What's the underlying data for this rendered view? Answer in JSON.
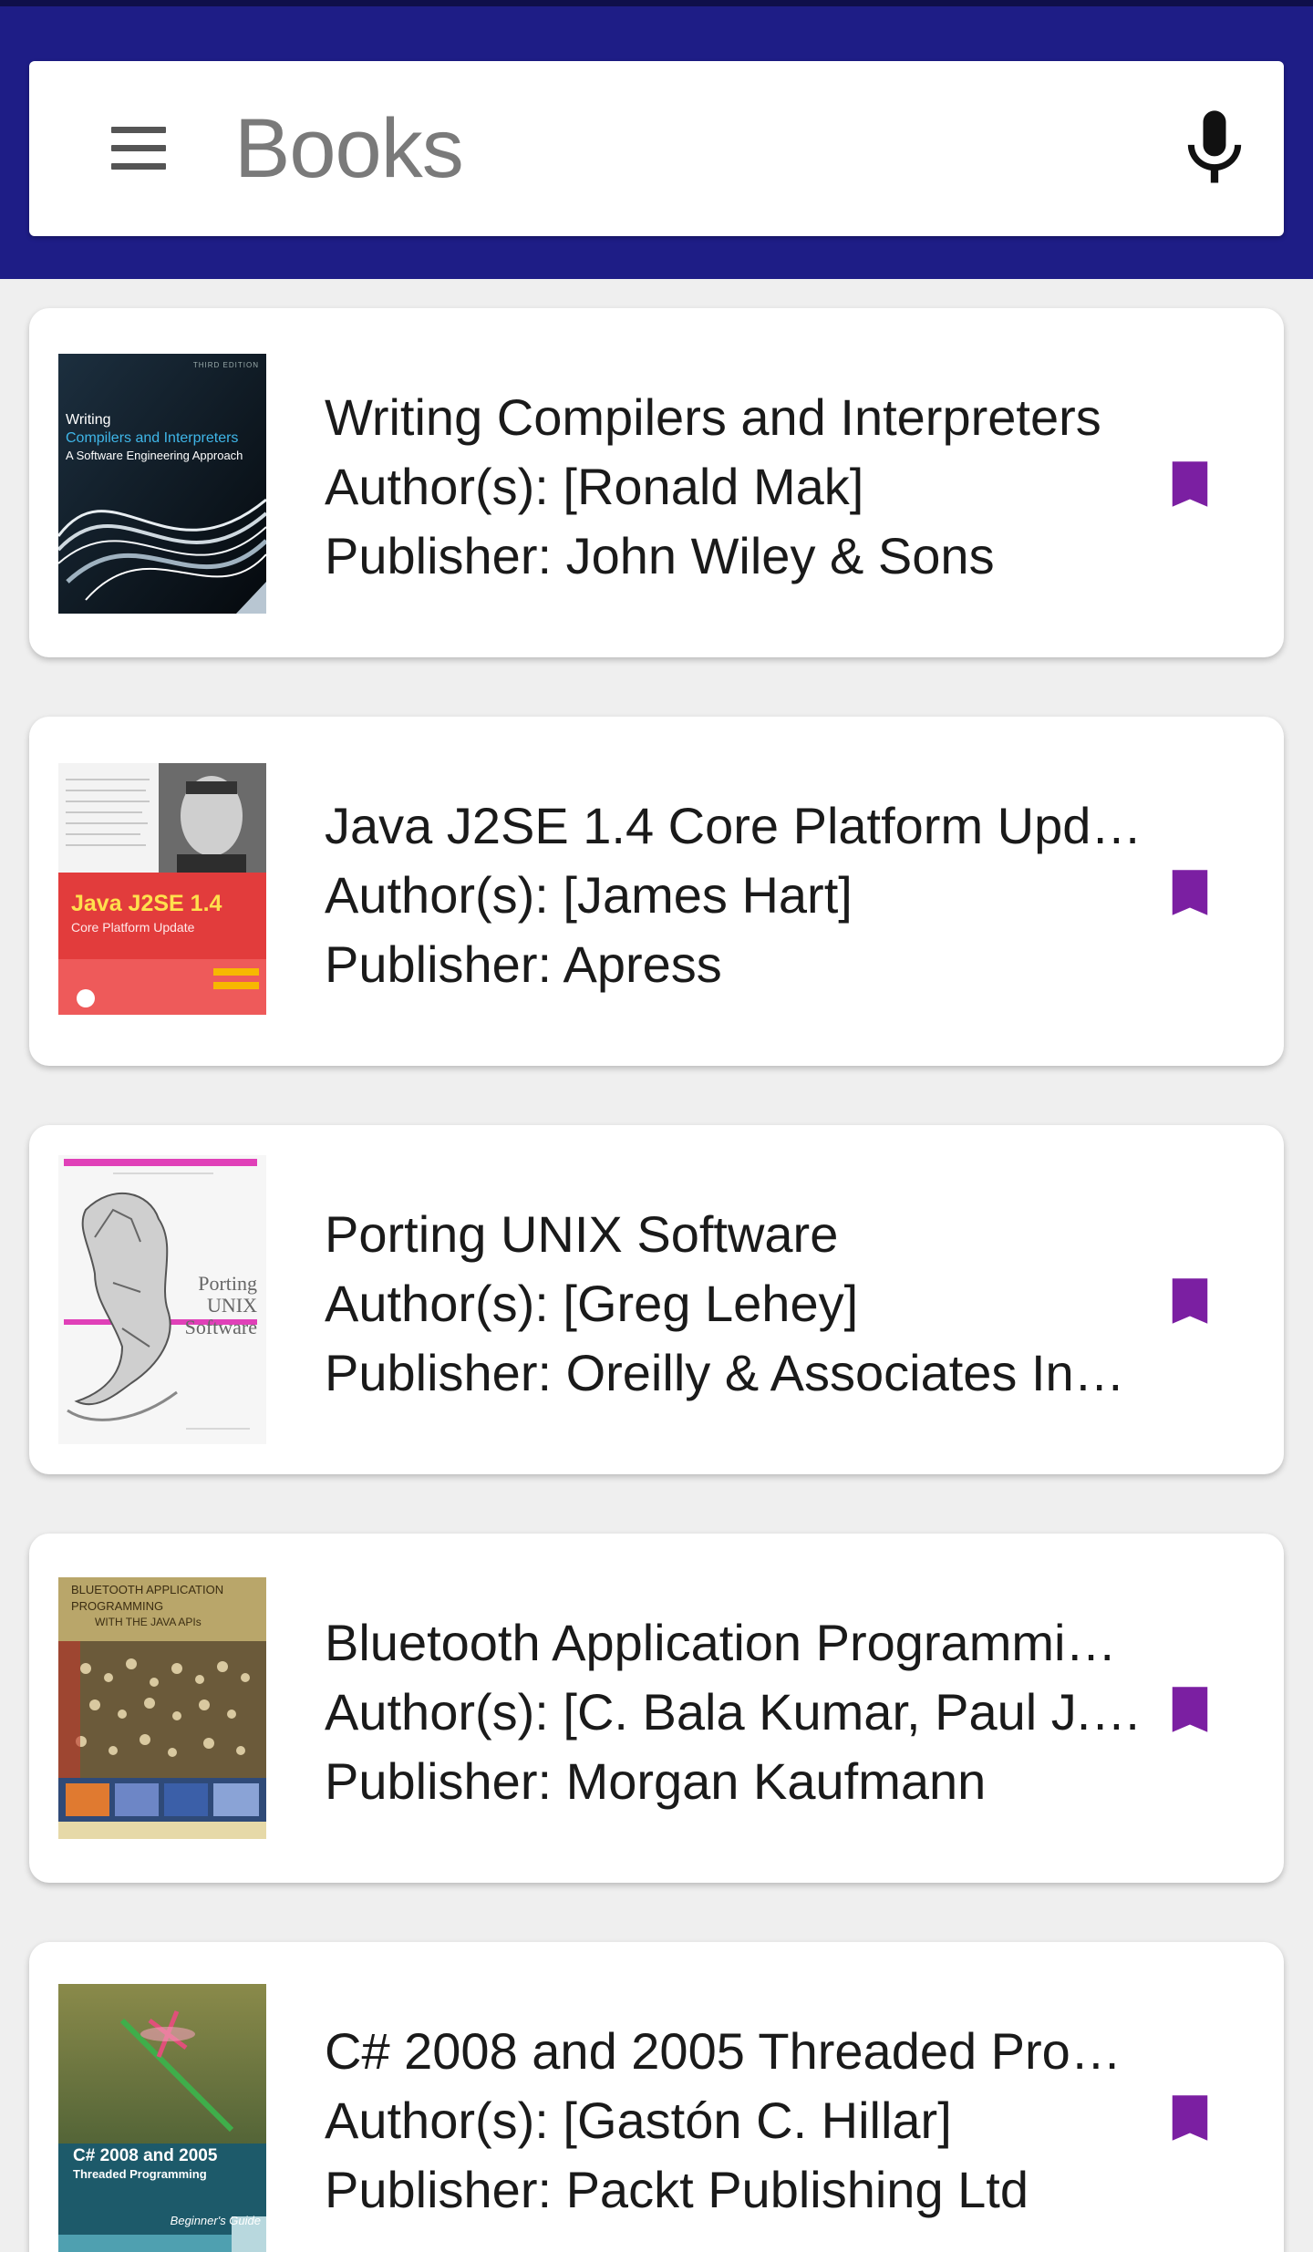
{
  "search": {
    "title": "Books"
  },
  "books": [
    {
      "title": "Writing Compilers and Interpreters",
      "author_line": "Author(s): [Ronald Mak]",
      "publisher_line": "Publisher: John Wiley & Sons",
      "cover": {
        "small": "THIRD EDITION",
        "l1": "Writing",
        "l2": "Compilers and Interpreters",
        "l3": "A Software Engineering Approach"
      }
    },
    {
      "title": "Java J2SE 1.4 Core Platform Upd…",
      "author_line": "Author(s): [James Hart]",
      "publisher_line": "Publisher: Apress",
      "cover": {
        "l1": "Java J2SE 1.4",
        "l2": "Core Platform Update"
      }
    },
    {
      "title": "Porting UNIX Software",
      "author_line": "Author(s): [Greg Lehey]",
      "publisher_line": "Publisher: Oreilly & Associates In…",
      "cover": {
        "l1": "Porting",
        "l2": "UNIX",
        "l3": "Software"
      }
    },
    {
      "title": "Bluetooth Application Programmi…",
      "author_line": "Author(s): [C. Bala Kumar, Paul J. …",
      "publisher_line": "Publisher: Morgan Kaufmann",
      "cover": {
        "l1": "BLUETOOTH APPLICATION",
        "l2": "PROGRAMMING",
        "l3": "WITH THE JAVA APIs"
      }
    },
    {
      "title": "C# 2008 and 2005 Threaded Prog…",
      "author_line": "Author(s): [Gastón C. Hillar]",
      "publisher_line": "Publisher: Packt Publishing Ltd",
      "cover": {
        "l1": "C# 2008 and 2005",
        "l2": "Threaded Programming",
        "l3": "Beginner's Guide"
      }
    }
  ],
  "colors": {
    "appbar": "#1e1d86",
    "bookmark": "#7b1fa2",
    "background": "#efefef"
  }
}
